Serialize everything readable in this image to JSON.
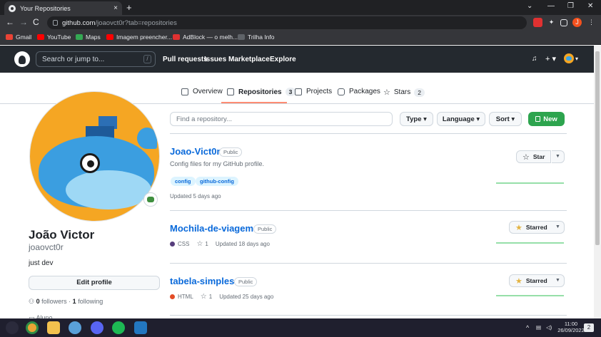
{
  "browser": {
    "tab_title": "Your Repositories",
    "tab_close": "×",
    "new_tab": "+",
    "url_host": "github.com",
    "url_path": "/joaovct0r?tab=repositories",
    "window_controls": [
      "⌄",
      "—",
      "❐",
      "✕"
    ],
    "nav": [
      "←",
      "→",
      "C"
    ],
    "profile_initial": "J",
    "bookmarks": [
      {
        "label": "Gmail",
        "color": "#ea4335"
      },
      {
        "label": "YouTube",
        "color": "#ff0000"
      },
      {
        "label": "Maps",
        "color": "#34a853"
      },
      {
        "label": "Imagem preencher...",
        "color": "#ff0000"
      },
      {
        "label": "AdBlock — o melh...",
        "color": "#e03131"
      },
      {
        "label": "Trilha Info",
        "color": "#5f6368"
      }
    ]
  },
  "header": {
    "search_placeholder": "Search or jump to...",
    "search_key": "/",
    "nav": [
      "Pull requests",
      "Issues",
      "Marketplace",
      "Explore"
    ],
    "bell": "🔔",
    "plus": "+ ▾",
    "avatar_caret": "▾"
  },
  "tabs": [
    {
      "label": "Overview",
      "count": ""
    },
    {
      "label": "Repositories",
      "count": "3"
    },
    {
      "label": "Projects",
      "count": ""
    },
    {
      "label": "Packages",
      "count": ""
    },
    {
      "label": "Stars",
      "count": "2"
    }
  ],
  "profile": {
    "name": "João Victor",
    "login": "joaovct0r",
    "bio": "just dev",
    "edit_label": "Edit profile",
    "followers_count": "0",
    "followers_label": "followers",
    "separator": "·",
    "following_count": "1",
    "following_label": "following",
    "partial_text": "Aluno"
  },
  "filters": {
    "find_placeholder": "Find a repository...",
    "type_label": "Type ▾",
    "language_label": "Language ▾",
    "sort_label": "Sort ▾",
    "new_label": "New"
  },
  "repos": [
    {
      "name": "Joao-Vict0r",
      "visibility": "Public",
      "description": "Config files for my GitHub profile.",
      "topics": [
        "config",
        "github-config"
      ],
      "updated": "Updated 5 days ago",
      "language": "",
      "language_color": "",
      "stars": "",
      "star_label": "Star",
      "starred": false
    },
    {
      "name": "Mochila-de-viagem",
      "visibility": "Public",
      "description": "",
      "topics": [],
      "updated": "Updated 18 days ago",
      "language": "CSS",
      "language_color": "#563d7c",
      "stars": "1",
      "star_label": "Starred",
      "starred": true
    },
    {
      "name": "tabela-simples",
      "visibility": "Public",
      "description": "",
      "topics": [],
      "updated": "Updated 25 days ago",
      "language": "HTML",
      "language_color": "#e34c26",
      "stars": "1",
      "star_label": "Starred",
      "starred": true
    }
  ],
  "taskbar": {
    "time": "11:00",
    "date": "26/09/2022",
    "notifications": "2",
    "tray_chevron": "^"
  }
}
